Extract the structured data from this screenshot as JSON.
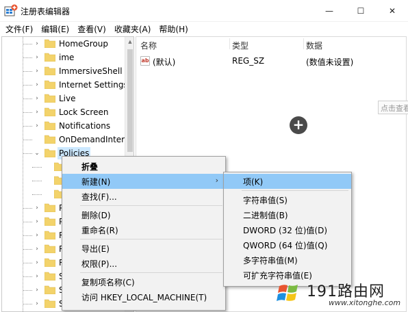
{
  "window": {
    "title": "注册表编辑器",
    "min_glyph": "—",
    "max_glyph": "☐",
    "close_glyph": "✕"
  },
  "menubar": [
    "文件(F)",
    "编辑(E)",
    "查看(V)",
    "收藏夹(A)",
    "帮助(H)"
  ],
  "tree": {
    "items": [
      {
        "label": "HomeGroup",
        "expander": "›"
      },
      {
        "label": "ime",
        "expander": "›"
      },
      {
        "label": "ImmersiveShell",
        "expander": "›"
      },
      {
        "label": "Internet Settings",
        "expander": "›"
      },
      {
        "label": "Live",
        "expander": "›"
      },
      {
        "label": "Lock Screen",
        "expander": "›"
      },
      {
        "label": "Notifications",
        "expander": "›"
      },
      {
        "label": "OnDemandInterfac",
        "expander": ""
      },
      {
        "label": "Policies",
        "expander": "⌄",
        "selected": true
      },
      {
        "label": "",
        "expander": ""
      },
      {
        "label": "",
        "expander": ""
      },
      {
        "label": "",
        "expander": ""
      },
      {
        "label": "P",
        "expander": "›"
      },
      {
        "label": "P",
        "expander": "›"
      },
      {
        "label": "R",
        "expander": "›"
      },
      {
        "label": "R",
        "expander": "›"
      },
      {
        "label": "R",
        "expander": "›"
      },
      {
        "label": "S",
        "expander": "›"
      },
      {
        "label": "S",
        "expander": "›"
      },
      {
        "label": "S",
        "expander": "›"
      }
    ]
  },
  "values_pane": {
    "headers": {
      "name": "名称",
      "type": "类型",
      "data": "数据"
    },
    "rows": [
      {
        "icon": "ab",
        "name": "(默认)",
        "type": "REG_SZ",
        "data": "(数值未设置)"
      }
    ]
  },
  "tooltip_stub": "点击查看",
  "plus_glyph": "+",
  "context_menu": {
    "items": [
      {
        "label": "折叠",
        "bold": true
      },
      {
        "label": "新建(N)",
        "highlight": true,
        "arrow": "›"
      },
      {
        "label": "查找(F)..."
      },
      {
        "label": "删除(D)"
      },
      {
        "label": "重命名(R)"
      },
      {
        "label": "导出(E)"
      },
      {
        "label": "权限(P)..."
      },
      {
        "label": "复制项名称(C)"
      },
      {
        "label": "访问 HKEY_LOCAL_MACHINE(T)"
      }
    ]
  },
  "submenu": {
    "items": [
      {
        "label": "项(K)",
        "highlight": true
      },
      {
        "label": "字符串值(S)"
      },
      {
        "label": "二进制值(B)"
      },
      {
        "label": "DWORD (32 位)值(D)"
      },
      {
        "label": "QWORD (64 位)值(Q)"
      },
      {
        "label": "多字符串值(M)"
      },
      {
        "label": "可扩充字符串值(E)"
      }
    ]
  },
  "watermark": {
    "text": "191路由网",
    "url": "www.xitonghe.com"
  },
  "colors": {
    "highlight": "#91c9f7",
    "selected_tree": "#cce8ff",
    "folder": "#f3d36b"
  }
}
